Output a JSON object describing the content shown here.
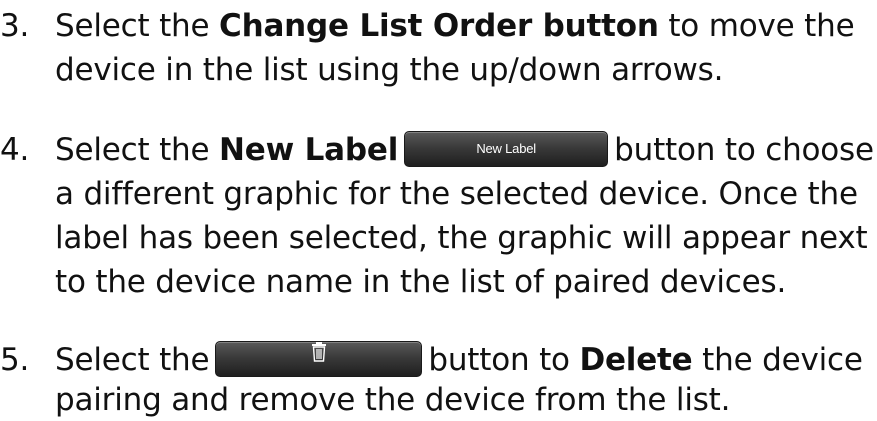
{
  "steps": [
    {
      "number": "3.",
      "line1_pre": "Select the ",
      "line1_bold": "Change List Order button",
      "line1_post": " to move the",
      "line2": "device in the list using the up/down arrows."
    },
    {
      "number": "4.",
      "line1_pre": "Select the ",
      "line1_bold": "New Label",
      "button_label": "New Label",
      "line1_post": "button to choose",
      "line2": "a different graphic for the selected device. Once the",
      "line3": "label has been selected, the graphic will appear next",
      "line4": "to the device name in the list of paired devices."
    },
    {
      "number": "5.",
      "line1_pre": "Select the",
      "button_icon": "trash-icon",
      "line1_mid": "button to ",
      "line1_bold": "Delete",
      "line1_post": " the device",
      "line2": "pairing and remove the device from the list."
    }
  ],
  "colors": {
    "text": "#111111",
    "button_top": "#5a5a5a",
    "button_bottom": "#1f1f1f",
    "button_text": "#ffffff"
  }
}
